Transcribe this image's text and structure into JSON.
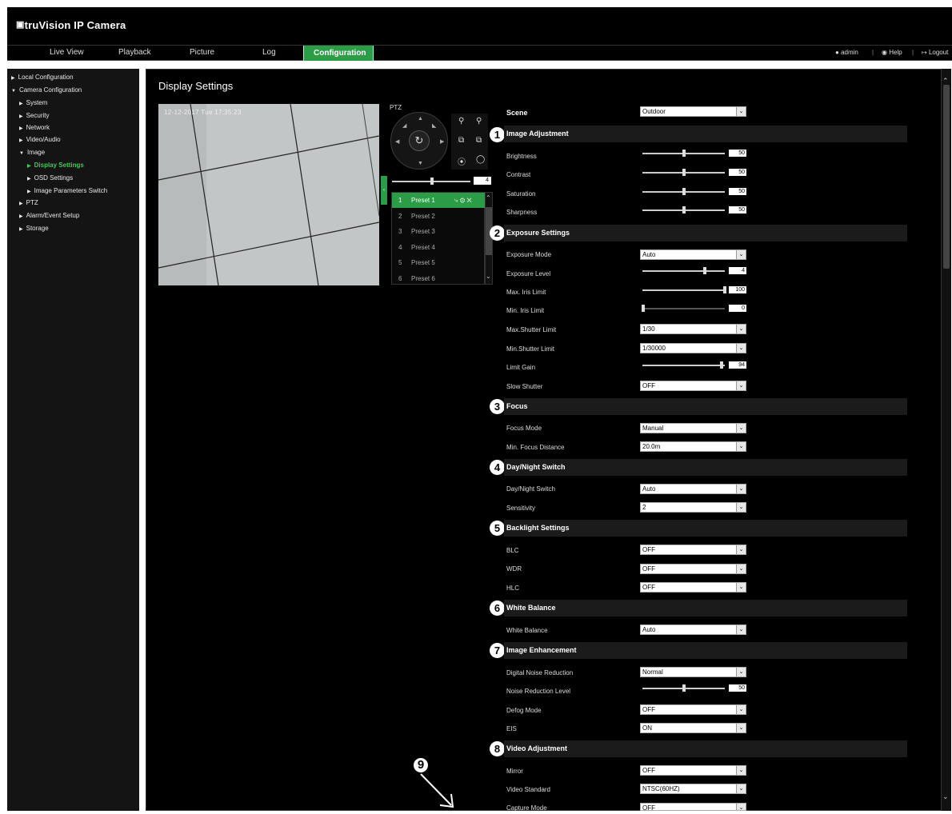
{
  "app": {
    "logo": "truVision IP Camera"
  },
  "nav": {
    "tabs": [
      "Live View",
      "Playback",
      "Picture",
      "Log",
      "Configuration"
    ],
    "user": {
      "admin": "admin",
      "help": "Help",
      "logout": "Logout"
    }
  },
  "sidebar": {
    "items": [
      {
        "label": "Local Configuration"
      },
      {
        "label": "Camera Configuration"
      },
      {
        "label": "System"
      },
      {
        "label": "Security"
      },
      {
        "label": "Network"
      },
      {
        "label": "Video/Audio"
      },
      {
        "label": "Image"
      },
      {
        "label": "Display Settings"
      },
      {
        "label": "OSD Settings"
      },
      {
        "label": "Image Parameters Switch"
      },
      {
        "label": "PTZ"
      },
      {
        "label": "Alarm/Event Setup"
      },
      {
        "label": "Storage"
      }
    ]
  },
  "page": {
    "title": "Display Settings",
    "timestamp": "12-12-2017 Tue 17:35:23"
  },
  "ptz": {
    "label": "PTZ",
    "speed": "4",
    "presets": [
      {
        "num": "1",
        "label": "Preset 1"
      },
      {
        "num": "2",
        "label": "Preset 2"
      },
      {
        "num": "3",
        "label": "Preset 3"
      },
      {
        "num": "4",
        "label": "Preset 4"
      },
      {
        "num": "5",
        "label": "Preset 5"
      },
      {
        "num": "6",
        "label": "Preset 6"
      }
    ]
  },
  "settings": {
    "scene": {
      "label": "Scene",
      "value": "Outdoor"
    },
    "sections": {
      "s1": {
        "num": "1",
        "title": "Image Adjustment"
      },
      "s2": {
        "num": "2",
        "title": "Exposure Settings"
      },
      "s3": {
        "num": "3",
        "title": "Focus"
      },
      "s4": {
        "num": "4",
        "title": "Day/Night Switch"
      },
      "s5": {
        "num": "5",
        "title": "Backlight Settings"
      },
      "s6": {
        "num": "6",
        "title": "White Balance"
      },
      "s7": {
        "num": "7",
        "title": "Image Enhancement"
      },
      "s8": {
        "num": "8",
        "title": "Video Adjustment"
      }
    },
    "brightness": {
      "label": "Brightness",
      "value": "50",
      "level": 0.5
    },
    "contrast": {
      "label": "Contrast",
      "value": "50",
      "level": 0.5
    },
    "saturation": {
      "label": "Saturation",
      "value": "50",
      "level": 0.5
    },
    "sharpness": {
      "label": "Sharpness",
      "value": "50",
      "level": 0.5
    },
    "exposure_mode": {
      "label": "Exposure Mode",
      "value": "Auto"
    },
    "exposure_level": {
      "label": "Exposure Level",
      "value": "4",
      "level": 0.75
    },
    "max_iris": {
      "label": "Max. Iris Limit",
      "value": "100",
      "level": 1.0
    },
    "min_iris": {
      "label": "Min. Iris Limit",
      "value": "0",
      "level": 0.0
    },
    "max_shutter": {
      "label": "Max.Shutter Limit",
      "value": "1/30"
    },
    "min_shutter": {
      "label": "Min.Shutter Limit",
      "value": "1/30000"
    },
    "limit_gain": {
      "label": "Limit Gain",
      "value": "94",
      "level": 0.94
    },
    "slow_shutter": {
      "label": "Slow Shutter",
      "value": "OFF"
    },
    "focus_mode": {
      "label": "Focus Mode",
      "value": "Manual"
    },
    "min_focus": {
      "label": "Min. Focus Distance",
      "value": "20.0m"
    },
    "daynight": {
      "label": "Day/Night Switch",
      "value": "Auto"
    },
    "sensitivity": {
      "label": "Sensitivity",
      "value": "2"
    },
    "blc": {
      "label": "BLC",
      "value": "OFF"
    },
    "wdr": {
      "label": "WDR",
      "value": "OFF"
    },
    "hlc": {
      "label": "HLC",
      "value": "OFF"
    },
    "white_balance": {
      "label": "White Balance",
      "value": "Auto"
    },
    "dnr": {
      "label": "Digital Noise Reduction",
      "value": "Normal"
    },
    "nr_level": {
      "label": "Noise Reduction Level",
      "value": "50",
      "level": 0.5
    },
    "defog": {
      "label": "Defog Mode",
      "value": "OFF"
    },
    "eis": {
      "label": "EIS",
      "value": "ON"
    },
    "mirror": {
      "label": "Mirror",
      "value": "OFF"
    },
    "video_standard": {
      "label": "Video Standard",
      "value": "NTSC(60HZ)"
    },
    "capture_mode": {
      "label": "Capture Mode",
      "value": "OFF"
    }
  },
  "callout": {
    "num": "9"
  },
  "colors": {
    "accent": "#2a9d46",
    "background": "#000000",
    "header_bg": "#1b1b1b"
  }
}
